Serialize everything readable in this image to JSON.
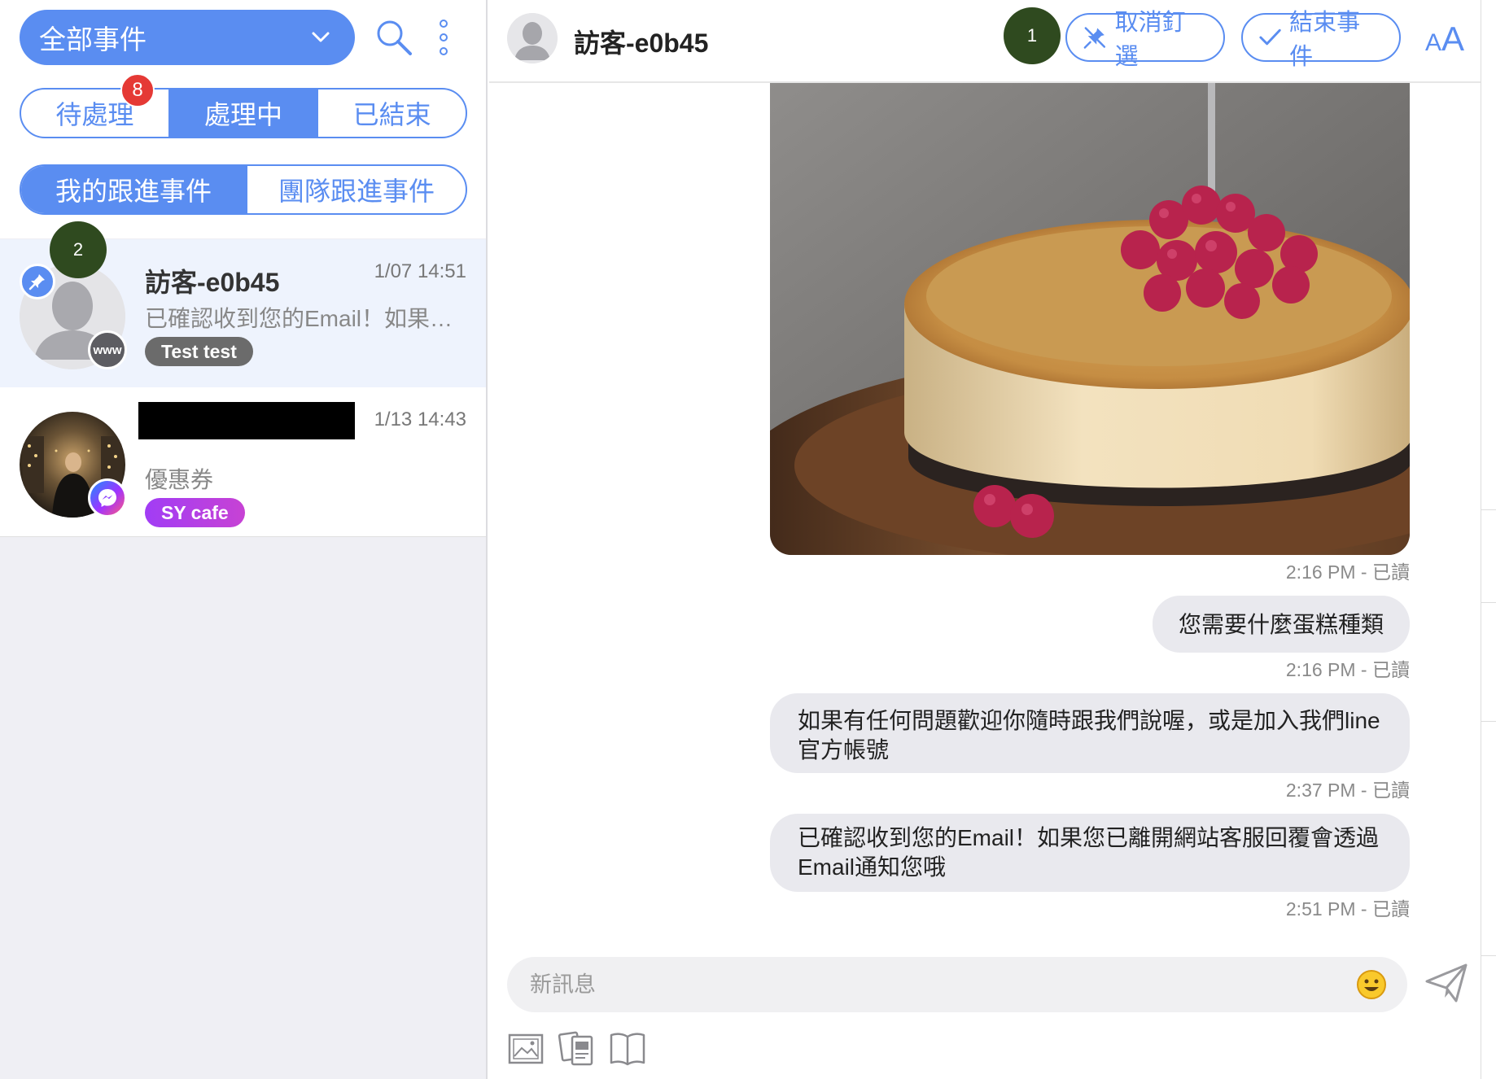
{
  "sidebar": {
    "event_filter": "全部事件",
    "status_tabs": [
      {
        "label": "待處理",
        "badge": "8"
      },
      {
        "label": "處理中"
      },
      {
        "label": "已結束"
      }
    ],
    "follow_tabs": [
      {
        "label": "我的跟進事件"
      },
      {
        "label": "團隊跟進事件"
      }
    ],
    "conversations": [
      {
        "name": "訪客-e0b45",
        "time": "1/07 14:51",
        "preview": "已確認收到您的Email！如果您已離開網站客服回覆會透過Email通知您哦",
        "tag": "Test test",
        "tag_color": "#6b6b6b",
        "channel_label": "www",
        "step_badge": "2"
      },
      {
        "name": "",
        "time": "1/13 14:43",
        "preview": "優惠券",
        "tag": "SY cafe",
        "tag_color": "#b13cf0"
      }
    ]
  },
  "header": {
    "name": "訪客-e0b45",
    "step_badge": "1",
    "unpin_label": "取消釘選",
    "end_label": "結束事件",
    "font_small": "A",
    "font_big": "A"
  },
  "messages": [
    {
      "type": "image",
      "stamp": "2:16 PM - 已讀"
    },
    {
      "type": "text",
      "text": "您需要什麼蛋糕種類",
      "stamp": "2:16 PM - 已讀"
    },
    {
      "type": "text",
      "text": "如果有任何問題歡迎你隨時跟我們說喔，或是加入我們line官方帳號",
      "stamp": "2:37 PM - 已讀"
    },
    {
      "type": "text",
      "text": "已確認收到您的Email！如果您已離開網站客服回覆會透過Email通知您哦",
      "stamp": "2:51 PM - 已讀"
    }
  ],
  "composer": {
    "placeholder": "新訊息",
    "tools": [
      "image-icon",
      "template-icon",
      "book-icon"
    ]
  },
  "colors": {
    "accent": "#5a8df1",
    "badge_red": "#e53935",
    "step_badge": "#2f4a1f",
    "bubble": "#e9e9ee"
  }
}
